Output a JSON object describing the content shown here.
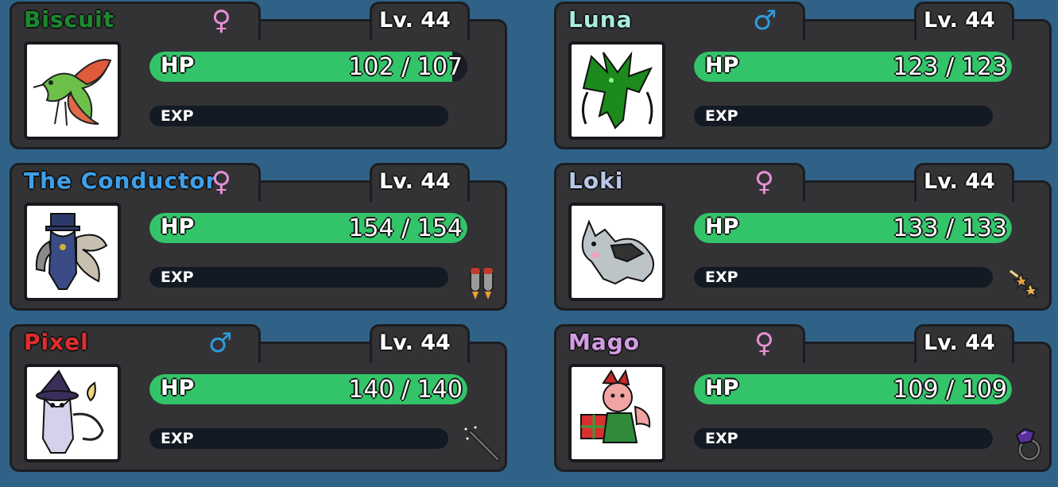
{
  "hp_label": "HP",
  "exp_label": "EXP",
  "colors": {
    "female": "#e88fd6",
    "male": "#2f9be0",
    "hp_fill": "#33c46a"
  },
  "party": [
    {
      "name": "Biscuit",
      "name_color": "#1b8a2e",
      "gender": "♀",
      "gender_type": "female",
      "level": "Lv. 44",
      "hp_text": "102 / 107",
      "hp_fraction": 0.953,
      "held_item": null,
      "portrait": "flying-bird-creature"
    },
    {
      "name": "Luna",
      "name_color": "#a8ecdf",
      "gender": "♂",
      "gender_type": "male",
      "level": "Lv. 44",
      "hp_text": "123 / 123",
      "hp_fraction": 1.0,
      "held_item": null,
      "portrait": "green-dragon-creature"
    },
    {
      "name": "The Conductor",
      "name_color": "#3ea0ea",
      "gender": "♀",
      "gender_type": "female",
      "level": "Lv. 44",
      "hp_text": "154 / 154",
      "hp_fraction": 1.0,
      "held_item": "jetpack-icon",
      "portrait": "conductor-creature"
    },
    {
      "name": "Loki",
      "name_color": "#b7c8e8",
      "gender": "♀",
      "gender_type": "female",
      "level": "Lv. 44",
      "hp_text": "133 / 133",
      "hp_fraction": 1.0,
      "held_item": "shooting-stars-icon",
      "portrait": "grey-wolf-creature"
    },
    {
      "name": "Pixel",
      "name_color": "#e22c2c",
      "gender": "♂",
      "gender_type": "male",
      "level": "Lv. 44",
      "hp_text": "140 / 140",
      "hp_fraction": 1.0,
      "held_item": "magic-wand-icon",
      "portrait": "witch-cat-creature"
    },
    {
      "name": "Mago",
      "name_color": "#d49ce4",
      "gender": "♀",
      "gender_type": "female",
      "level": "Lv. 44",
      "hp_text": "109 / 109",
      "hp_fraction": 1.0,
      "held_item": "gem-ring-icon",
      "portrait": "jester-fox-creature"
    }
  ]
}
